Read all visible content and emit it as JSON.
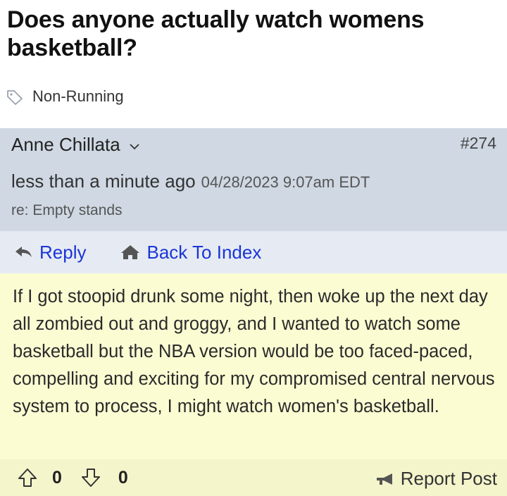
{
  "thread": {
    "title": "Does anyone actually watch womens basketball?",
    "tag_icon": "tag-icon",
    "tag": "Non-Running"
  },
  "post": {
    "author": "Anne Chillata",
    "post_number": "#274",
    "relative_time": "less than a minute ago",
    "absolute_time": "04/28/2023 9:07am EDT",
    "reply_to": "re: Empty stands",
    "body": "If I got stoopid drunk some night, then woke up the next day all zombied out and groggy, and I wanted to watch some basketball but the NBA version would be too faced-paced, compelling and exciting for my compromised central nervous system to process, I might watch women's basketball.",
    "upvotes": "0",
    "downvotes": "0"
  },
  "actions": {
    "reply_label": "Reply",
    "back_label": "Back To Index",
    "report_label": "Report Post"
  },
  "colors": {
    "header_bg": "#cfd8e3",
    "actions_bg": "#e6ebf3",
    "body_bg": "#fcfcd3",
    "footer_bg": "#f5f5cc",
    "link": "#1a35d6"
  }
}
